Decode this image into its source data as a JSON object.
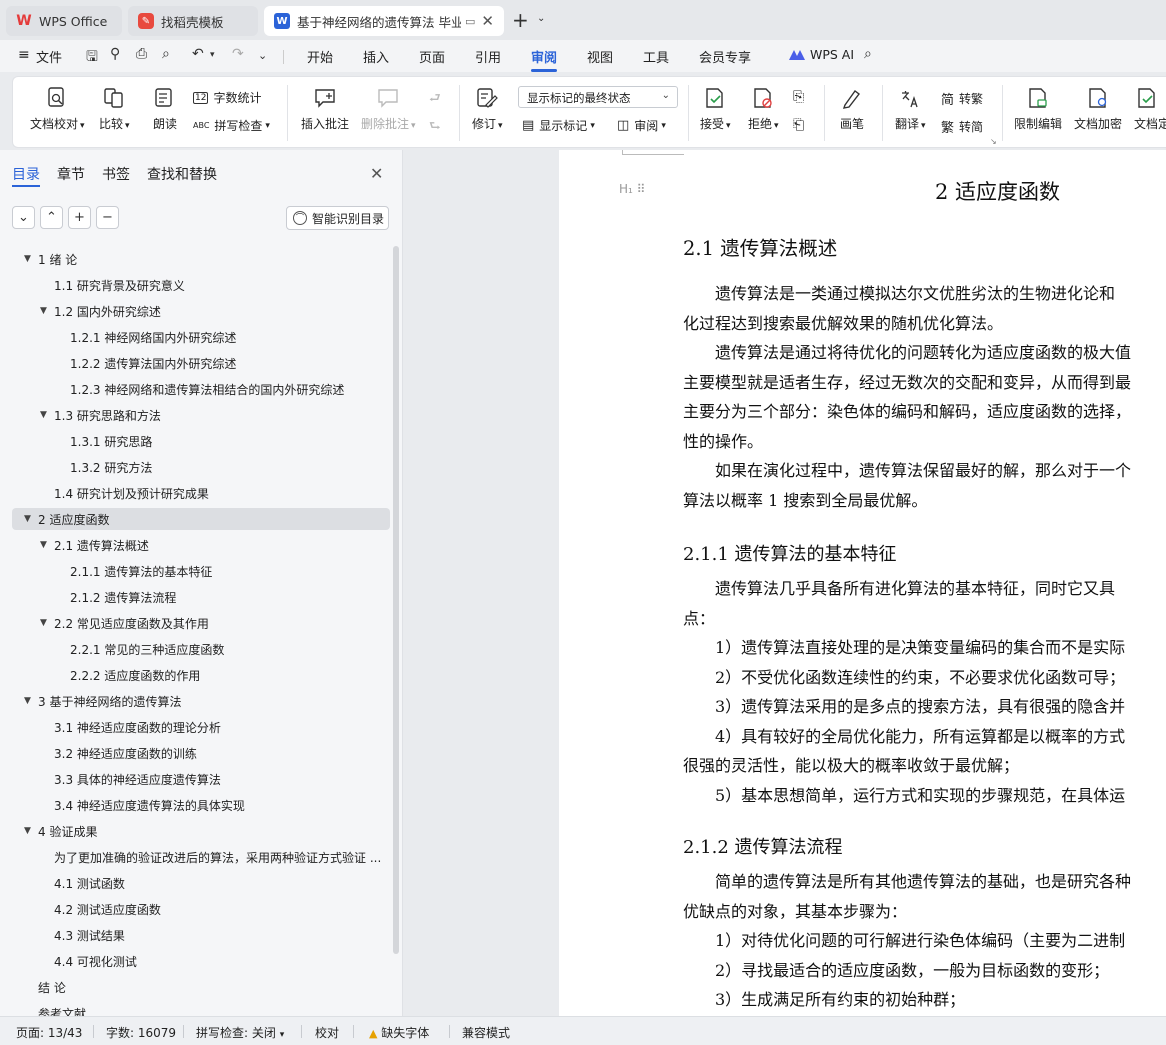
{
  "tabs": [
    {
      "label": "WPS Office"
    },
    {
      "label": "找稻壳模板"
    },
    {
      "label": "基于神经网络的遗传算法 毕业"
    }
  ],
  "menu": {
    "file": "文件",
    "items": [
      "开始",
      "插入",
      "页面",
      "引用",
      "审阅",
      "视图",
      "工具",
      "会员专享"
    ],
    "active": "审阅",
    "wps_ai": "WPS AI"
  },
  "ribbon": {
    "doc_check": "文档校对",
    "compare": "比较",
    "read_aloud": "朗读",
    "word_count": "字数统计",
    "spell_check": "拼写检查",
    "insert_comment": "插入批注",
    "delete_comment": "删除批注",
    "revise": "修订",
    "markup_state": "显示标记的最终状态",
    "show_markup": "显示标记",
    "review": "审阅",
    "accept": "接受",
    "reject": "拒绝",
    "pen": "画笔",
    "translate": "翻译",
    "to_trad": "转繁",
    "to_simp": "转简",
    "restrict_edit": "限制编辑",
    "encrypt": "文档加密",
    "doc_more": "文档定"
  },
  "panel": {
    "tabs": [
      "目录",
      "章节",
      "书签",
      "查找和替换"
    ],
    "smart_toc": "智能识别目录",
    "toc": [
      {
        "label": "1  绪  论",
        "level": 1,
        "arrow": true
      },
      {
        "label": "1.1  研究背景及研究意义",
        "level": 2,
        "arrow": false
      },
      {
        "label": "1.2  国内外研究综述",
        "level": 2,
        "arrow": true
      },
      {
        "label": "1.2.1  神经网络国内外研究综述",
        "level": 3,
        "arrow": false
      },
      {
        "label": "1.2.2  遗传算法国内外研究综述",
        "level": 3,
        "arrow": false
      },
      {
        "label": "1.2.3  神经网络和遗传算法相结合的国内外研究综述",
        "level": 3,
        "arrow": false
      },
      {
        "label": "1.3  研究思路和方法",
        "level": 2,
        "arrow": true
      },
      {
        "label": "1.3.1  研究思路",
        "level": 3,
        "arrow": false
      },
      {
        "label": "1.3.2  研究方法",
        "level": 3,
        "arrow": false
      },
      {
        "label": "1.4 研究计划及预计研究成果",
        "level": 2,
        "arrow": false
      },
      {
        "label": "2  适应度函数",
        "level": 1,
        "arrow": true,
        "selected": true
      },
      {
        "label": "2.1  遗传算法概述",
        "level": 2,
        "arrow": true
      },
      {
        "label": "2.1.1  遗传算法的基本特征",
        "level": 3,
        "arrow": false
      },
      {
        "label": "2.1.2  遗传算法流程",
        "level": 3,
        "arrow": false
      },
      {
        "label": "2.2  常见适应度函数及其作用",
        "level": 2,
        "arrow": true
      },
      {
        "label": "2.2.1  常见的三种适应度函数",
        "level": 3,
        "arrow": false
      },
      {
        "label": "2.2.2  适应度函数的作用",
        "level": 3,
        "arrow": false
      },
      {
        "label": "3  基于神经网络的遗传算法",
        "level": 1,
        "arrow": true
      },
      {
        "label": "3.1  神经适应度函数的理论分析",
        "level": 2,
        "arrow": false
      },
      {
        "label": "3.2  神经适应度函数的训练",
        "level": 2,
        "arrow": false
      },
      {
        "label": "3.3  具体的神经适应度遗传算法",
        "level": 2,
        "arrow": false
      },
      {
        "label": "3.4  神经适应度遗传算法的具体实现",
        "level": 2,
        "arrow": false
      },
      {
        "label": "4  验证成果",
        "level": 1,
        "arrow": true
      },
      {
        "label": "为了更加准确的验证改进后的算法，采用两种验证方式验证 ...",
        "level": 2,
        "arrow": false
      },
      {
        "label": "4.1  测试函数",
        "level": 2,
        "arrow": false
      },
      {
        "label": "4.2  测试适应度函数",
        "level": 2,
        "arrow": false
      },
      {
        "label": "4.3  测试结果",
        "level": 2,
        "arrow": false
      },
      {
        "label": "4.4  可视化测试",
        "level": 2,
        "arrow": false
      },
      {
        "label": "结  论",
        "level": 1,
        "arrow": false
      },
      {
        "label": "参考文献",
        "level": 1,
        "arrow": false
      }
    ]
  },
  "document": {
    "chapter_title": "2  适应度函数",
    "s21_title": "2.1  遗传算法概述",
    "s21_lines": [
      "　　遗传算法是一类通过模拟达尔文优胜劣汰的生物进化论和",
      "化过程达到搜索最优解效果的随机优化算法。",
      "　　遗传算法是通过将待优化的问题转化为适应度函数的极大值",
      "主要模型就是适者生存，经过无数次的交配和变异，从而得到最",
      "主要分为三个部分：染色体的编码和解码，适应度函数的选择，",
      "性的操作。",
      "　　如果在演化过程中，遗传算法保留最好的解，那么对于一个",
      "算法以概率 1 搜索到全局最优解。"
    ],
    "s211_title": "2.1.1  遗传算法的基本特征",
    "s211_lines": [
      "　　遗传算法几乎具备所有进化算法的基本特征，同时它又具",
      "点：",
      "　　1）遗传算法直接处理的是决策变量编码的集合而不是实际",
      "　　2）不受优化函数连续性的约束，不必要求优化函数可导；",
      "　　3）遗传算法采用的是多点的搜索方法，具有很强的隐含并",
      "　　4）具有较好的全局优化能力，所有运算都是以概率的方式",
      "很强的灵活性，能以极大的概率收敛于最优解；",
      "　　5）基本思想简单，运行方式和实现的步骤规范，在具体运"
    ],
    "s212_title": "2.1.2  遗传算法流程",
    "s212_lines": [
      "　　简单的遗传算法是所有其他遗传算法的基础，也是研究各种",
      "优缺点的对象，其基本步骤为：",
      "　　1）对待优化问题的可行解进行染色体编码（主要为二进制",
      "　　2）寻找最适合的适应度函数，一般为目标函数的变形；",
      "　　3）生成满足所有约束的初始种群；"
    ]
  },
  "status": {
    "page": "页面: 13/43",
    "words": "字数: 16079",
    "spell": "拼写检查: 关闭",
    "proof": "校对",
    "missing_font": "缺失字体",
    "compat": "兼容模式"
  },
  "colors": {
    "accent": "#2b63d8",
    "wps_red": "#e43b3b"
  }
}
